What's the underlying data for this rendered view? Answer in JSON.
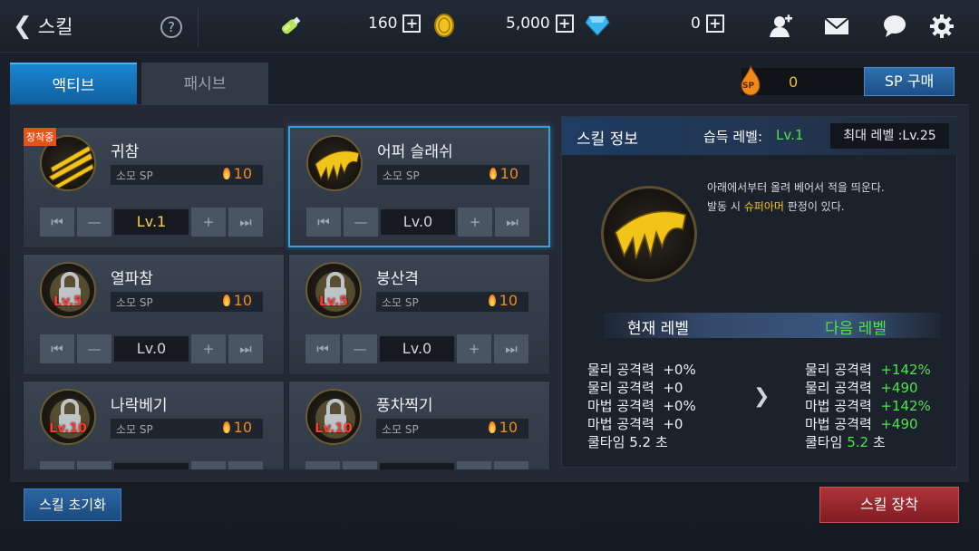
{
  "header": {
    "title": "스킬",
    "help": "?"
  },
  "resources": {
    "energy": {
      "value": "160",
      "plus": "+"
    },
    "gold": {
      "value": "5,000",
      "plus": "+"
    },
    "gem": {
      "value": "0",
      "plus": "+"
    }
  },
  "tabs": [
    {
      "label": "액티브"
    },
    {
      "label": "패시브"
    }
  ],
  "sp": {
    "icon_text": "SP",
    "value": "0",
    "buy_label": "SP 구매"
  },
  "skills": [
    {
      "name": "귀참",
      "sp_label": "소모 SP",
      "sp_cost": "10",
      "level": "Lv.1",
      "badge": "장착중",
      "locked_label": ""
    },
    {
      "name": "어퍼 슬래쉬",
      "sp_label": "소모 SP",
      "sp_cost": "10",
      "level": "Lv.0",
      "badge": "",
      "locked_label": ""
    },
    {
      "name": "열파참",
      "sp_label": "소모 SP",
      "sp_cost": "10",
      "level": "Lv.0",
      "badge": "",
      "locked_label": "Lv.5"
    },
    {
      "name": "붕산격",
      "sp_label": "소모 SP",
      "sp_cost": "10",
      "level": "Lv.0",
      "badge": "",
      "locked_label": "Lv.5"
    },
    {
      "name": "나락베기",
      "sp_label": "소모 SP",
      "sp_cost": "10",
      "level": "",
      "badge": "",
      "locked_label": "Lv.10"
    },
    {
      "name": "풍차찍기",
      "sp_label": "소모 SP",
      "sp_cost": "10",
      "level": "",
      "badge": "",
      "locked_label": "Lv.10"
    }
  ],
  "info": {
    "title": "스킬 정보",
    "acquire_label": "습득 레벨:",
    "acquire_value": "Lv.1",
    "max_level": "최대 레벨 :Lv.25",
    "desc_line1": "아래에서부터 올려 베어서 적을 띄운다.",
    "desc_line2_a": "발동 시 ",
    "desc_line2_hl": "슈퍼아머",
    "desc_line2_b": " 판정이 있다.",
    "current_title": "현재 레벨",
    "next_title": "다음 레벨",
    "current_stats": [
      {
        "label": "물리 공격력",
        "value": "+0%"
      },
      {
        "label": "물리 공격력",
        "value": "+0"
      },
      {
        "label": "마법 공격력",
        "value": "+0%"
      },
      {
        "label": "마법 공격력",
        "value": "+0"
      }
    ],
    "current_cooldown": {
      "label": "쿨타임",
      "value": "5.2",
      "unit": "초"
    },
    "next_stats": [
      {
        "label": "물리 공격력",
        "value": "+142%"
      },
      {
        "label": "물리 공격력",
        "value": "+490"
      },
      {
        "label": "마법 공격력",
        "value": "+142%"
      },
      {
        "label": "마법 공격력",
        "value": "+490"
      }
    ],
    "next_cooldown": {
      "label": "쿨타임",
      "value": "5.2",
      "unit": "초"
    }
  },
  "buttons": {
    "reset": "스킬 초기화",
    "equip": "스킬 장착"
  },
  "colors": {
    "accent_blue": "#1a86d3",
    "equip_red": "#b0333a",
    "green": "#4ee44a",
    "sp_orange": "#f08a1a"
  }
}
